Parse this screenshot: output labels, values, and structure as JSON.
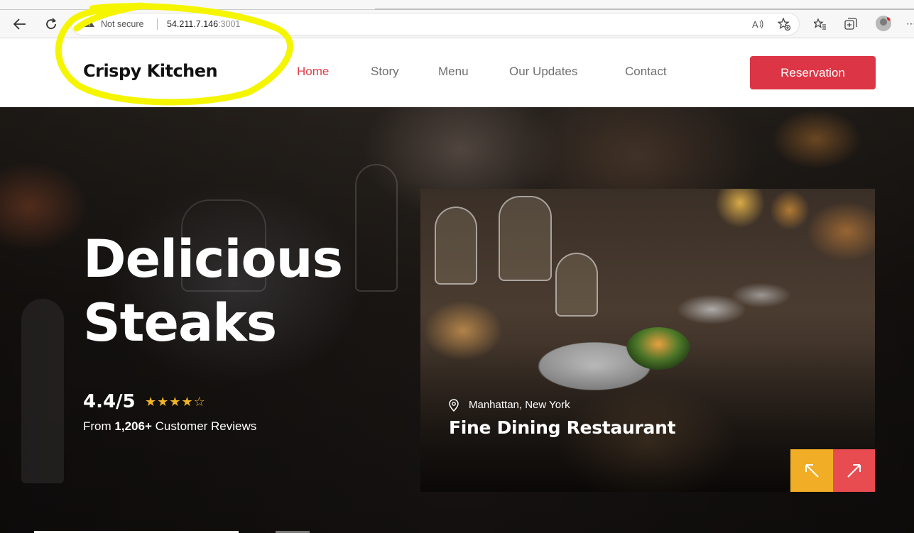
{
  "browser": {
    "security_label": "Not secure",
    "url_host": "54.211.7.146",
    "url_port": ":3001"
  },
  "site": {
    "brand": "Crispy Kitchen",
    "nav": [
      {
        "label": "Home",
        "active": true
      },
      {
        "label": "Story",
        "active": false
      },
      {
        "label": "Menu",
        "active": false
      },
      {
        "label": "Our Updates",
        "active": false
      },
      {
        "label": "Contact",
        "active": false
      }
    ],
    "reservation_label": "Reservation",
    "accent_color": "#dc3545"
  },
  "hero": {
    "title_line1": "Delicious",
    "title_line2": "Steaks",
    "rating": "4.4/5",
    "stars_filled": 4,
    "stars_total": 5,
    "reviews_prefix": "From",
    "reviews_count": "1,206+",
    "reviews_suffix": "Customer Reviews"
  },
  "card": {
    "location": "Manhattan, New York",
    "title": "Fine Dining Restaurant",
    "prev_color": "#f0ad25",
    "next_color": "#e84c50"
  },
  "icons": {
    "back": "back-arrow-icon",
    "reload": "reload-icon",
    "warning": "warning-icon",
    "read_aloud": "read-aloud-icon",
    "favorite": "add-favorite-icon",
    "favorites": "favorites-icon",
    "collections": "collections-icon",
    "profile": "profile-icon",
    "location": "location-pin-icon",
    "prev": "arrow-up-left-icon",
    "next": "arrow-up-right-icon"
  }
}
